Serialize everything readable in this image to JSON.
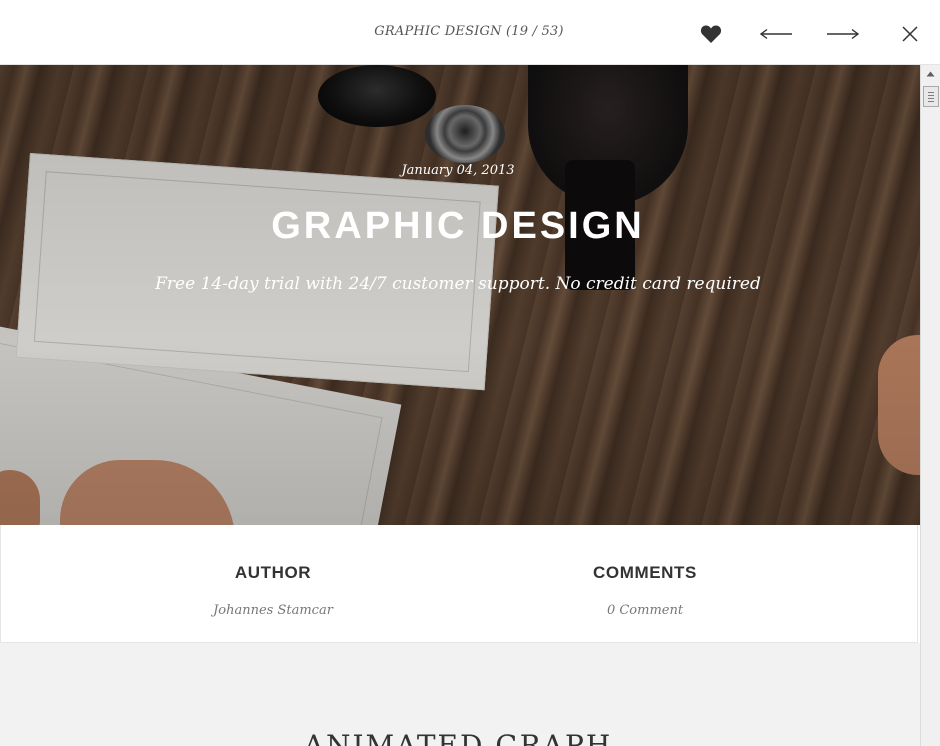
{
  "topbar": {
    "title": "GRAPHIC DESIGN (19 / 53)",
    "icons": {
      "favorite": "heart-icon",
      "prev": "arrow-left-icon",
      "next": "arrow-right-icon",
      "close": "close-icon"
    }
  },
  "hero": {
    "date": "January 04, 2013",
    "title": "GRAPHIC DESIGN",
    "subtitle": "Free 14-day trial with 24/7 customer support. No credit card required"
  },
  "meta": {
    "author_label": "AUTHOR",
    "author_value": "Johannes Stamcar",
    "comments_label": "COMMENTS",
    "comments_value": "0 Comment"
  },
  "section": {
    "title": "ANIMATED GRAPH"
  },
  "colors": {
    "topbar_bg": "#ffffff",
    "text_dark": "#333333",
    "text_muted": "#777777",
    "lower_bg": "#f2f2f2"
  }
}
